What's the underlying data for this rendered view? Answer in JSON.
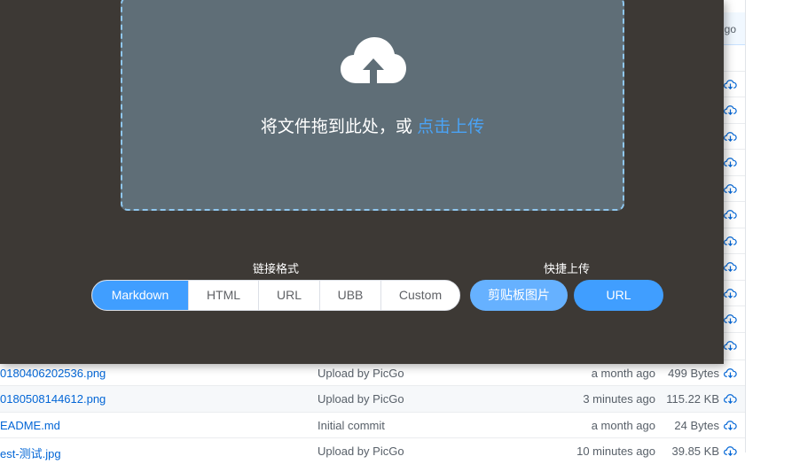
{
  "background_list": {
    "header_age": "go",
    "rows": [
      {
        "name": "0180406202536.png",
        "message": "Upload by PicGo",
        "age": "a month ago",
        "size": "499 Bytes"
      },
      {
        "name": "0180508144612.png",
        "message": "Upload by PicGo",
        "age": "3 minutes ago",
        "size": "115.22 KB"
      },
      {
        "name": "EADME.md",
        "message": "Initial commit",
        "age": "a month ago",
        "size": "24 Bytes"
      },
      {
        "name": "est-测试.jpg",
        "message": "Upload by PicGo",
        "age": "10 minutes ago",
        "size": "39.85 KB"
      }
    ]
  },
  "upload_panel": {
    "drop_text": "将文件拖到此处，或 ",
    "drop_link": "点击上传",
    "format_label": "链接格式",
    "formats": [
      "Markdown",
      "HTML",
      "URL",
      "UBB",
      "Custom"
    ],
    "active_format": "Markdown",
    "quick_label": "快捷上传",
    "clipboard_button": "剪贴板图片",
    "url_button": "URL"
  },
  "colors": {
    "panel_bg": "#3d3935",
    "drop_zone_bg": "#5f6e77",
    "accent": "#409eff",
    "link": "#0366d6"
  }
}
